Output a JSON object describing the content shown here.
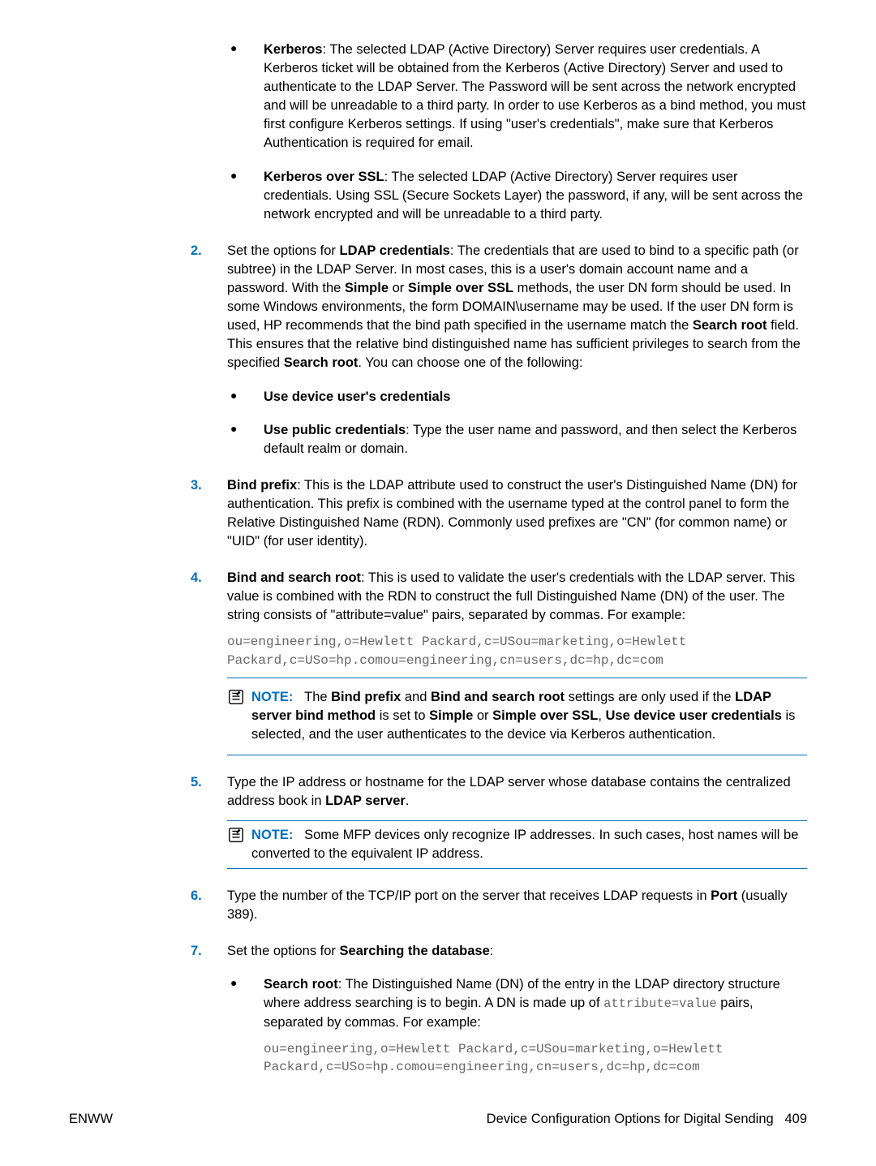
{
  "bullets_top": [
    {
      "title": "Kerberos",
      "text": ": The selected LDAP (Active Directory) Server requires user credentials. A Kerberos ticket will be obtained from the Kerberos (Active Directory) Server and used to authenticate to the LDAP Server. The Password will be sent across the network encrypted and will be unreadable to a third party. In order to use Kerberos as a bind method, you must first configure Kerberos settings. If using \"user's credentials\", make sure that Kerberos Authentication is required for email."
    },
    {
      "title": "Kerberos over SSL",
      "text": ": The selected LDAP (Active Directory) Server requires user credentials. Using SSL (Secure Sockets Layer) the password, if any, will be sent across the network encrypted and will be unreadable to a third party."
    }
  ],
  "step2": {
    "num": "2.",
    "lead": "Set the options for ",
    "bold1": "LDAP credentials",
    "text1": ": The credentials that are used to bind to a specific path (or subtree) in the LDAP Server. In most cases, this is a user's domain account name and a password. With the ",
    "bold2": "Simple",
    "text2": " or ",
    "bold3": "Simple over SSL",
    "text3": " methods, the user DN form should be used. In some Windows environments, the form DOMAIN\\username may be used. If the user DN form is used, HP recommends that the bind path specified in the username match the ",
    "bold4": "Search root",
    "text4": " field. This ensures that the relative bind distinguished name has sufficient privileges to search from the specified ",
    "bold5": "Search root",
    "text5": ". You can choose one of the following:",
    "sub": [
      {
        "title": "Use device user's credentials",
        "text": ""
      },
      {
        "title": "Use public credentials",
        "text": ": Type the user name and password, and then select the Kerberos default realm or domain."
      }
    ]
  },
  "step3": {
    "num": "3.",
    "bold": "Bind prefix",
    "text": ": This is the LDAP attribute used to construct the user's Distinguished Name (DN) for authentication. This prefix is combined with the username typed at the control panel to form the Relative Distinguished Name (RDN). Commonly used prefixes are \"CN\" (for common name) or \"UID\" (for user identity)."
  },
  "step4": {
    "num": "4.",
    "bold": "Bind and search root",
    "text": ": This is used to validate the user's credentials with the LDAP server. This value is combined with the RDN to construct the full Distinguished Name (DN) of the user. The string consists of \"attribute=value\" pairs, separated by commas. For example:",
    "code": "ou=engineering,o=Hewlett Packard,c=USou=marketing,o=Hewlett\nPackard,c=USo=hp.comou=engineering,cn=users,dc=hp,dc=com",
    "note": {
      "label": "NOTE:",
      "part1": "The ",
      "b1": "Bind prefix",
      "part2": " and ",
      "b2": "Bind and search root",
      "part3": " settings are only used if the ",
      "b3": "LDAP server bind method",
      "part4": " is set to ",
      "b4": "Simple",
      "part5": " or ",
      "b5": "Simple over SSL",
      "part6": ", ",
      "b6": "Use device user credentials",
      "part7": " is selected, and the user authenticates to the device via Kerberos authentication."
    }
  },
  "step5": {
    "num": "5.",
    "text1": "Type the IP address or hostname for the LDAP server whose database contains the centralized address book in ",
    "bold": "LDAP server",
    "text2": ".",
    "note": {
      "label": "NOTE:",
      "text": "Some MFP devices only recognize IP addresses. In such cases, host names will be converted to the equivalent IP address."
    }
  },
  "step6": {
    "num": "6.",
    "text1": "Type the number of the TCP/IP port on the server that receives LDAP requests in ",
    "bold": "Port",
    "text2": " (usually 389)."
  },
  "step7": {
    "num": "7.",
    "text1": "Set the options for ",
    "bold": "Searching the database",
    "text2": ":",
    "sub": {
      "title": "Search root",
      "text1": ": The Distinguished Name (DN) of the entry in the LDAP directory structure where address searching is to begin. A DN is made up of ",
      "code_inline": "attribute=value",
      "text2": " pairs, separated by commas. For example:",
      "code": "ou=engineering,o=Hewlett Packard,c=USou=marketing,o=Hewlett\nPackard,c=USo=hp.comou=engineering,cn=users,dc=hp,dc=com"
    }
  },
  "footer": {
    "left": "ENWW",
    "right_text": "Device Configuration Options for Digital Sending",
    "page_no": "409"
  }
}
